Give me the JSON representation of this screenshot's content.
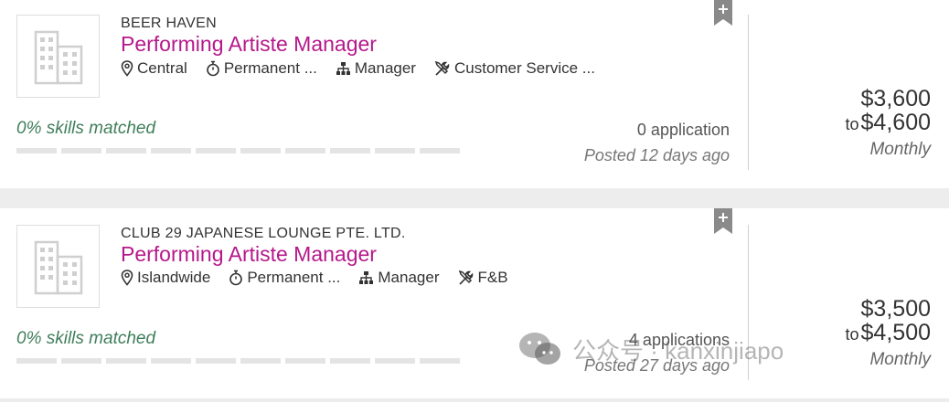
{
  "jobs": [
    {
      "company": "BEER HAVEN",
      "title": "Performing Artiste Manager",
      "location": "Central",
      "employment_type": "Permanent ...",
      "level": "Manager",
      "category": "Customer Service ...",
      "skills_matched": "0% skills matched",
      "applications": "0 application",
      "posted": "Posted 12 days ago",
      "salary_min": "$3,600",
      "salary_to": "to",
      "salary_max": "$4,600",
      "salary_period": "Monthly"
    },
    {
      "company": "CLUB 29 JAPANESE LOUNGE PTE. LTD.",
      "title": "Performing Artiste Manager",
      "location": "Islandwide",
      "employment_type": "Permanent ...",
      "level": "Manager",
      "category": "F&B",
      "skills_matched": "0% skills matched",
      "applications": "4 applications",
      "posted": "Posted 27 days ago",
      "salary_min": "$3,500",
      "salary_to": "to",
      "salary_max": "$4,500",
      "salary_period": "Monthly"
    }
  ],
  "watermark": {
    "text": "公众号 · kanxinjiapo"
  },
  "colors": {
    "title": "#b5188a",
    "skills": "#3f7e5a",
    "divider": "#ededed"
  },
  "icons": [
    "building-icon",
    "location-pin-icon",
    "stopwatch-icon",
    "org-chart-icon",
    "tools-icon",
    "bookmark-plus-icon",
    "wechat-icon"
  ]
}
